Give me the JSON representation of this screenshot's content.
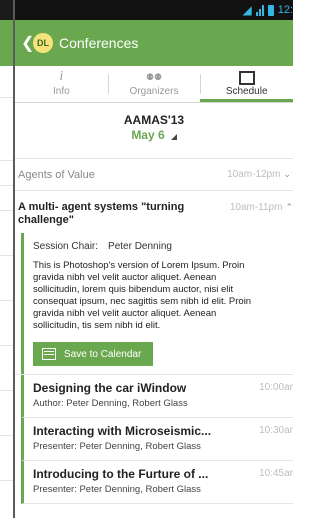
{
  "status_bar": {
    "time": "12:"
  },
  "app_bar": {
    "back_glyph": "❮",
    "logo_text": "DL",
    "title": "Conferences"
  },
  "tabs": [
    {
      "label": "Info",
      "icon": "info-icon",
      "glyph": "i"
    },
    {
      "label": "Organizers",
      "icon": "people-icon",
      "glyph": "⚉⚉"
    },
    {
      "label": "Schedule",
      "icon": "schedule-icon",
      "glyph": ""
    }
  ],
  "conference": {
    "name": "AAMAS'13",
    "date": "May 6"
  },
  "tracks": [
    {
      "name": "Agents of Value",
      "time": "10am-12pm"
    }
  ],
  "session": {
    "title": "A multi- agent systems \"turning challenge\"",
    "time": "10am-11pm",
    "chair_label": "Session Chair:",
    "chair_name": "Peter Denning",
    "description": "This is Photoshop's version  of Lorem Ipsum. Proin gravida nibh vel velit auctor aliquet. Aenean sollicitudin, lorem quis bibendum auctor, nisi elit consequat ipsum, nec sagittis sem nibh id elit. Proin gravida nibh vel velit auctor aliquet. Aenean sollicitudin, tis sem nibh id elit.",
    "calendar_button": "Save to Calendar"
  },
  "talks": [
    {
      "title": "Designing the car iWindow",
      "people": "Author:  Peter Denning, Robert Glass",
      "time": "10:00ar"
    },
    {
      "title": "Interacting with Microseismic...",
      "people": "Presenter: Peter Denning, Robert Glass",
      "time": "10:30ar"
    },
    {
      "title": "Introducing to the Furture of ...",
      "people": "Presenter: Peter Denning, Robert Glass",
      "time": "10:45ar"
    }
  ],
  "colors": {
    "brand": "#6aa84f",
    "status_accent": "#33b5e5"
  }
}
